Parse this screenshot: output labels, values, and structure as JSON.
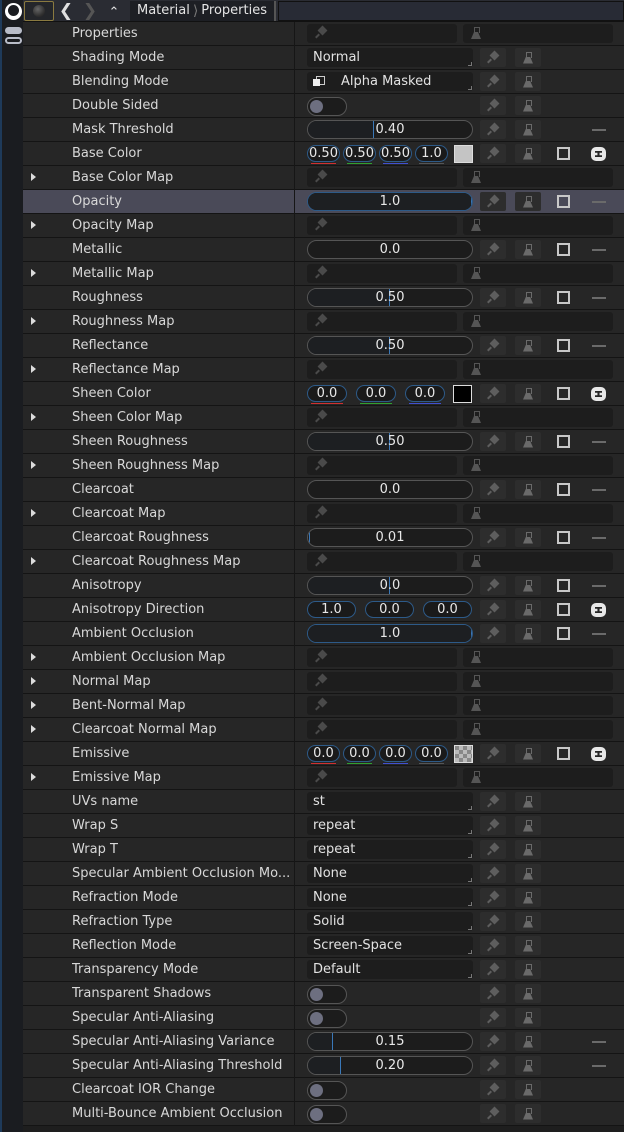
{
  "header": {
    "breadcrumb": [
      "Material",
      "Properties"
    ],
    "back_icon": "chevron-left-icon",
    "forward_icon": "chevron-right-icon",
    "up_icon": "double-chevron-up-icon"
  },
  "colors": {
    "accent_blue": "#2d5a88",
    "highlight_row": "#4a4a58",
    "red_channel": "#d03030",
    "green_channel": "#30a030",
    "blue_channel": "#4050d0"
  },
  "rows": [
    {
      "label": "Properties",
      "type": "map"
    },
    {
      "label": "Shading Mode",
      "type": "combo",
      "value": "Normal"
    },
    {
      "label": "Blending Mode",
      "type": "combo",
      "value": "Alpha Masked",
      "icon": "blend-icon"
    },
    {
      "label": "Double Sided",
      "type": "toggle",
      "value": false
    },
    {
      "label": "Mask Threshold",
      "type": "slider",
      "value": "0.40",
      "fill": 0.4,
      "dash": true
    },
    {
      "label": "Base Color",
      "type": "color4",
      "values": [
        "0.50",
        "0.50",
        "0.50",
        "1.0"
      ],
      "swatch": "#c4c4c4",
      "check": true,
      "link": true
    },
    {
      "label": "Base Color Map",
      "type": "map",
      "expandable": true
    },
    {
      "label": "Opacity",
      "type": "slider",
      "value": "1.0",
      "fill": 1.0,
      "check": true,
      "dash": true,
      "highlight": true
    },
    {
      "label": "Opacity Map",
      "type": "map",
      "expandable": true
    },
    {
      "label": "Metallic",
      "type": "slider",
      "value": "0.0",
      "fill": 0.0,
      "check": true,
      "dash": true
    },
    {
      "label": "Metallic Map",
      "type": "map",
      "expandable": true
    },
    {
      "label": "Roughness",
      "type": "slider",
      "value": "0.50",
      "fill": 0.5,
      "check": true,
      "dash": true
    },
    {
      "label": "Roughness Map",
      "type": "map",
      "expandable": true
    },
    {
      "label": "Reflectance",
      "type": "slider",
      "value": "0.50",
      "fill": 0.5,
      "check": true,
      "dash": true
    },
    {
      "label": "Reflectance Map",
      "type": "map",
      "expandable": true
    },
    {
      "label": "Sheen Color",
      "type": "color3",
      "values": [
        "0.0",
        "0.0",
        "0.0"
      ],
      "swatch": "#000000",
      "check": true,
      "link": true
    },
    {
      "label": "Sheen Color Map",
      "type": "map",
      "expandable": true
    },
    {
      "label": "Sheen Roughness",
      "type": "slider",
      "value": "0.50",
      "fill": 0.5,
      "check": true,
      "dash": true
    },
    {
      "label": "Sheen Roughness Map",
      "type": "map",
      "expandable": true
    },
    {
      "label": "Clearcoat",
      "type": "slider",
      "value": "0.0",
      "fill": 0.0,
      "check": true,
      "dash": true
    },
    {
      "label": "Clearcoat Map",
      "type": "map",
      "expandable": true
    },
    {
      "label": "Clearcoat Roughness",
      "type": "slider",
      "value": "0.01",
      "fill": 0.01,
      "check": true,
      "dash": true
    },
    {
      "label": "Clearcoat Roughness Map",
      "type": "map",
      "expandable": true
    },
    {
      "label": "Anisotropy",
      "type": "slider",
      "value": "0.0",
      "fill": 0.5,
      "check": true,
      "dash": true
    },
    {
      "label": "Anisotropy Direction",
      "type": "vec3",
      "values": [
        "1.0",
        "0.0",
        "0.0"
      ],
      "check": true,
      "link": true
    },
    {
      "label": "Ambient Occlusion",
      "type": "slider",
      "value": "1.0",
      "fill": 1.0,
      "check": true,
      "dash": true
    },
    {
      "label": "Ambient Occlusion Map",
      "type": "map",
      "expandable": true
    },
    {
      "label": "Normal Map",
      "type": "map",
      "expandable": true
    },
    {
      "label": "Bent-Normal Map",
      "type": "map",
      "expandable": true
    },
    {
      "label": "Clearcoat Normal Map",
      "type": "map",
      "expandable": true
    },
    {
      "label": "Emissive",
      "type": "color4",
      "values": [
        "0.0",
        "0.0",
        "0.0",
        "0.0"
      ],
      "swatch": "checker",
      "check": true,
      "link": true
    },
    {
      "label": "Emissive Map",
      "type": "map",
      "expandable": true
    },
    {
      "label": "UVs name",
      "type": "combo",
      "value": "st"
    },
    {
      "label": "Wrap S",
      "type": "combo",
      "value": "repeat"
    },
    {
      "label": "Wrap T",
      "type": "combo",
      "value": "repeat"
    },
    {
      "label": "Specular Ambient Occlusion Mo...",
      "type": "combo",
      "value": "None"
    },
    {
      "label": "Refraction Mode",
      "type": "combo",
      "value": "None"
    },
    {
      "label": "Refraction Type",
      "type": "combo",
      "value": "Solid"
    },
    {
      "label": "Reflection Mode",
      "type": "combo",
      "value": "Screen-Space"
    },
    {
      "label": "Transparency Mode",
      "type": "combo",
      "value": "Default"
    },
    {
      "label": "Transparent Shadows",
      "type": "toggle",
      "value": false
    },
    {
      "label": "Specular Anti-Aliasing",
      "type": "toggle",
      "value": false
    },
    {
      "label": "Specular Anti-Aliasing Variance",
      "type": "slider",
      "value": "0.15",
      "fill": 0.15,
      "dash": true
    },
    {
      "label": "Specular Anti-Aliasing Threshold",
      "type": "slider",
      "value": "0.20",
      "fill": 0.2,
      "dash": true
    },
    {
      "label": "Clearcoat IOR Change",
      "type": "toggle",
      "value": false
    },
    {
      "label": "Multi-Bounce Ambient Occlusion",
      "type": "toggle",
      "value": false
    }
  ]
}
